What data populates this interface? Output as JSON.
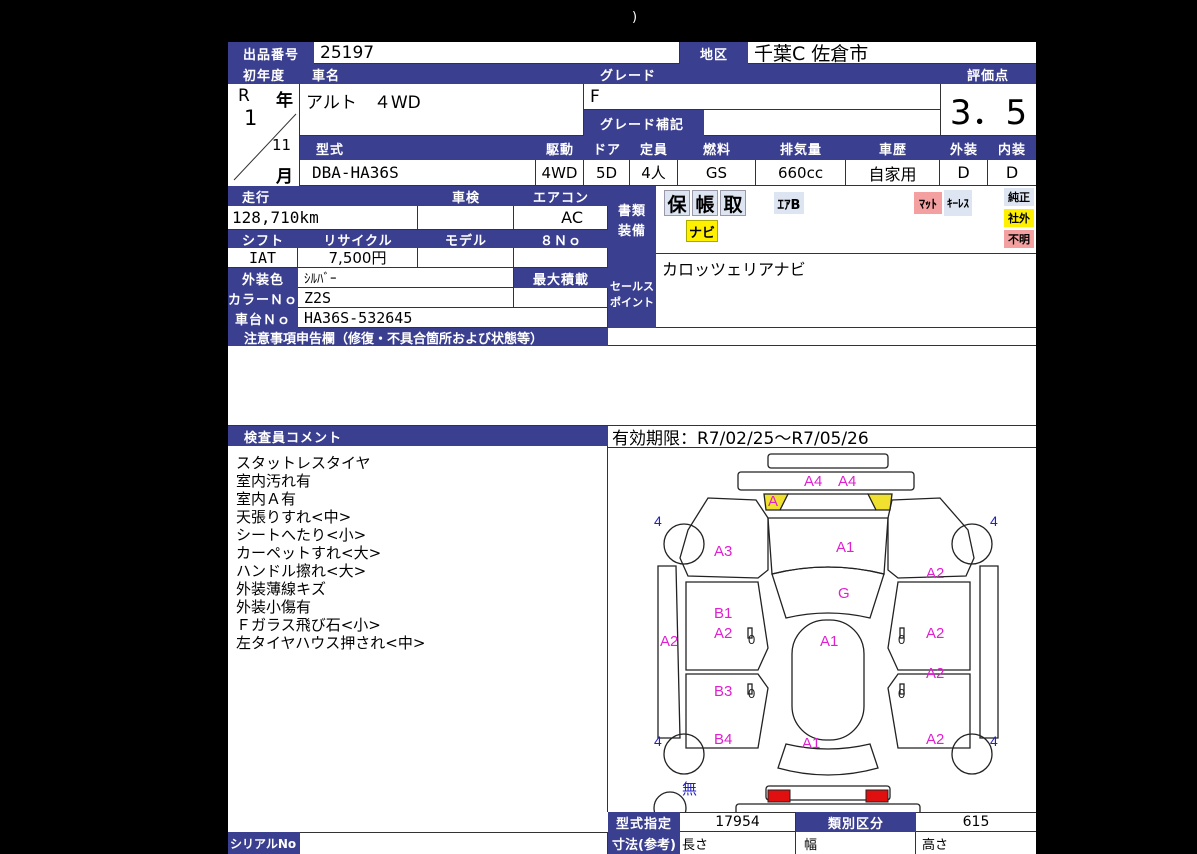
{
  "top_mark": ")",
  "lot": {
    "label": "出品番号",
    "value": "25197"
  },
  "region": {
    "label": "地区",
    "value": "千葉C 佐倉市"
  },
  "first_reg": {
    "label": "初年度",
    "era": "R",
    "nen": "年",
    "year": "1",
    "month": "11",
    "tsuki": "月"
  },
  "car_name": {
    "label": "車名",
    "value": "アルト　４WD"
  },
  "grade": {
    "label": "グレード",
    "value": "F",
    "supp_label": "グレード補記"
  },
  "score": {
    "label": "評価点",
    "value": "3．5"
  },
  "row2_labels": {
    "model_code": "型式",
    "drive": "駆動",
    "door": "ドア",
    "capacity": "定員",
    "fuel": "燃料",
    "displacement": "排気量",
    "history": "車歴",
    "exterior": "外装",
    "interior": "内装"
  },
  "row2_values": {
    "model_code": "DBA-HA36S",
    "drive": "4WD",
    "door": "5D",
    "capacity": "4人",
    "fuel": "GS",
    "displacement": "660cc",
    "history": "自家用",
    "exterior": "D",
    "interior": "D"
  },
  "mileage": {
    "label": "走行",
    "value": "128,710km"
  },
  "inspection": {
    "label": "車検",
    "value": ""
  },
  "aircon": {
    "label": "エアコン",
    "value": "AC"
  },
  "shift": {
    "label": "シフト",
    "value": "IAT"
  },
  "recycle": {
    "label": "リサイクル",
    "value": "7,500円"
  },
  "model": {
    "label": "モデル",
    "value": ""
  },
  "eight_no": {
    "label": "８Ｎｏ",
    "value": ""
  },
  "exterior_color": {
    "label": "外装色",
    "value": "ｼﾙﾊﾞｰ"
  },
  "max_load": {
    "label": "最大積載",
    "value": ""
  },
  "color_no": {
    "label": "カラーＮｏ",
    "value": "Z2S"
  },
  "chassis_no": {
    "label": "車台Ｎｏ",
    "value": "HA36S-532645"
  },
  "docs": {
    "label1": "書類",
    "label2": "装備"
  },
  "equipment": {
    "ho": "保",
    "cho": "帳",
    "tori": "取",
    "ab": "ｴｱB",
    "mat": "ﾏｯﾄ",
    "keyless": "ｷｰﾚｽ",
    "navi": "ナビ"
  },
  "genuine": {
    "junsei": "純正",
    "shagai": "社外",
    "fumei": "不明"
  },
  "sales": {
    "label1": "セールス",
    "label2": "ポイント",
    "value": "カロッツェリアナビ"
  },
  "notice": {
    "label": "注意事項申告欄（修復・不具合箇所および状態等）"
  },
  "inspector": {
    "label": "検査員コメント",
    "lines": [
      "スタットレスタイヤ",
      "室内汚れ有",
      "室内Ａ有",
      "天張りすれ<中>",
      "シートへたり<小>",
      "カーペットすれ<大>",
      "ハンドル擦れ<大>",
      "外装薄線キズ",
      "外装小傷有",
      "Ｆガラス飛び石<小>",
      "左タイヤハウス押され<中>"
    ]
  },
  "validity": {
    "label": "有効期限：R7/02/25〜R7/05/26"
  },
  "diagram": {
    "marks": {
      "a4_1": "A4",
      "a4_2": "A4",
      "a_front": "A",
      "a3": "A3",
      "a1_hood": "A1",
      "g": "G",
      "a2_r1": "A2",
      "b1": "B1",
      "a2_l1": "A2",
      "a2_left": "A2",
      "a1_roof": "A1",
      "a2_r2": "A2",
      "a2_r3": "A2",
      "b3": "B3",
      "b4": "B4",
      "a1_rear": "A1",
      "a2_r4": "A2",
      "a2_bumper": "A2",
      "a1_bumper": "A1",
      "t_fl": "4",
      "t_fr": "4",
      "t_rl": "4",
      "t_rr": "4",
      "spare": "無",
      "zero1": "0",
      "zero2": "0",
      "zero3": "0",
      "zero4": "0"
    },
    "mark_color": "#e020d0",
    "tire_color": "#2020c0"
  },
  "type_designation": {
    "label": "型式指定",
    "value": "17954"
  },
  "category": {
    "label": "類別区分",
    "value": "615"
  },
  "dimensions": {
    "label": "寸法(参考)",
    "length": "長さ",
    "width": "幅",
    "height": "高さ"
  },
  "serial": {
    "label": "シリアルNo",
    "value": ""
  }
}
